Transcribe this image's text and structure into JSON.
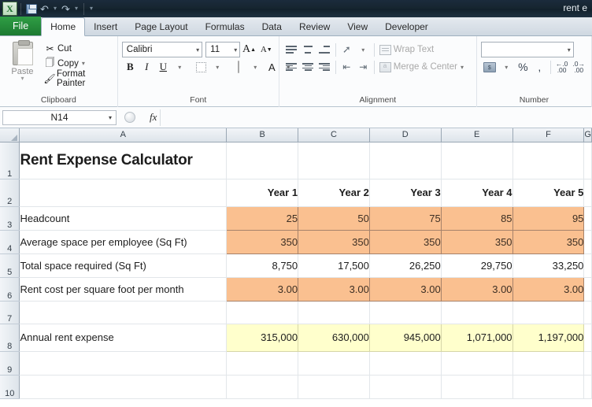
{
  "window": {
    "title": "rent e",
    "quick_access": [
      {
        "name": "save",
        "glyph": "save-icon"
      },
      {
        "name": "undo",
        "glyph": "undo-icon"
      },
      {
        "name": "redo",
        "glyph": "redo-icon"
      },
      {
        "name": "customize",
        "glyph": "chevron-down-icon"
      }
    ]
  },
  "ribbon": {
    "tabs": [
      {
        "label": "File",
        "active": false,
        "file": true
      },
      {
        "label": "Home",
        "active": true
      },
      {
        "label": "Insert",
        "active": false
      },
      {
        "label": "Page Layout",
        "active": false
      },
      {
        "label": "Formulas",
        "active": false
      },
      {
        "label": "Data",
        "active": false
      },
      {
        "label": "Review",
        "active": false
      },
      {
        "label": "View",
        "active": false
      },
      {
        "label": "Developer",
        "active": false
      }
    ],
    "clipboard": {
      "label": "Clipboard",
      "paste": "Paste",
      "cut": "Cut",
      "copy": "Copy",
      "format_painter": "Format Painter"
    },
    "font": {
      "label": "Font",
      "font_name": "Calibri",
      "font_size": "11",
      "bold": "B",
      "italic": "I",
      "underline": "U",
      "grow": "A",
      "shrink": "A"
    },
    "alignment": {
      "label": "Alignment",
      "wrap_text": "Wrap Text",
      "merge_center": "Merge & Center"
    },
    "number": {
      "label": "Number",
      "format_value": "",
      "percent": "%",
      "comma": ","
    }
  },
  "formula_bar": {
    "name_box": "N14",
    "formula": ""
  },
  "sheet": {
    "columns": [
      "A",
      "B",
      "C",
      "D",
      "E",
      "F",
      "G"
    ],
    "row_numbers": [
      "1",
      "2",
      "3",
      "4",
      "5",
      "6",
      "7",
      "8",
      "9",
      "10"
    ],
    "title": "Rent Expense Calculator",
    "headers": [
      "Year 1",
      "Year 2",
      "Year 3",
      "Year 4",
      "Year 5"
    ],
    "rows": [
      {
        "label": "Headcount",
        "style": "input",
        "values": [
          "25",
          "50",
          "75",
          "85",
          "95"
        ]
      },
      {
        "label": "Average space per employee (Sq Ft)",
        "style": "input",
        "values": [
          "350",
          "350",
          "350",
          "350",
          "350"
        ]
      },
      {
        "label": "Total space required (Sq Ft)",
        "style": "calc",
        "values": [
          "8,750",
          "17,500",
          "26,250",
          "29,750",
          "33,250"
        ]
      },
      {
        "label": "Rent cost per square foot per month",
        "style": "input",
        "values": [
          "3.00",
          "3.00",
          "3.00",
          "3.00",
          "3.00"
        ]
      },
      {
        "label": "",
        "style": "blank",
        "values": [
          "",
          "",
          "",
          "",
          ""
        ]
      },
      {
        "label": "Annual rent expense",
        "style": "result",
        "values": [
          "315,000",
          "630,000",
          "945,000",
          "1,071,000",
          "1,197,000"
        ]
      }
    ]
  },
  "colors": {
    "input_fill": "#fac090",
    "result_fill": "#ffffcc",
    "file_tab": "#1d7a31",
    "title_bar": "#16252f"
  }
}
